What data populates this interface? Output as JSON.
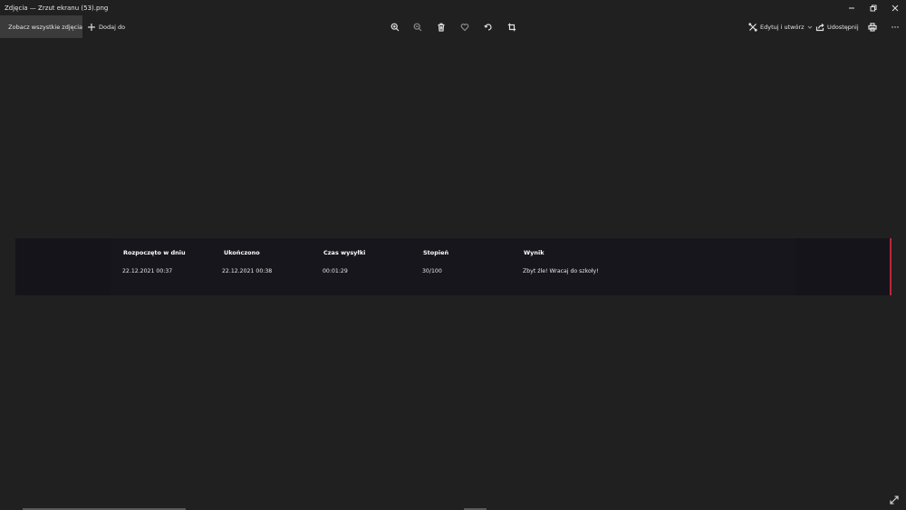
{
  "window": {
    "title": "Zdjęcia — Zrzut ekranu (53).png"
  },
  "toolbar": {
    "see_all_label": "Zobacz wszystkie zdjęcia",
    "add_to_label": "Dodaj do",
    "edit_create_label": "Edytuj i utwórz",
    "share_label": "Udostępnij",
    "icons": [
      "zoom-in-icon",
      "zoom-out-icon",
      "delete-icon",
      "favorite-icon",
      "rotate-icon",
      "crop-icon",
      "print-icon",
      "more-icon"
    ]
  },
  "table": {
    "headers": [
      "Rozpoczęto w dniu",
      "Ukończono",
      "Czas wysyłki",
      "Stopień",
      "Wynik"
    ],
    "row": [
      "22.12.2021 00:37",
      "22.12.2021 00:38",
      "00:01:29",
      "30/100",
      "Zbyt źle! Wracaj do szkoły!"
    ]
  },
  "colors": {
    "background": "#202020",
    "accent_edge": "#b8283a"
  }
}
